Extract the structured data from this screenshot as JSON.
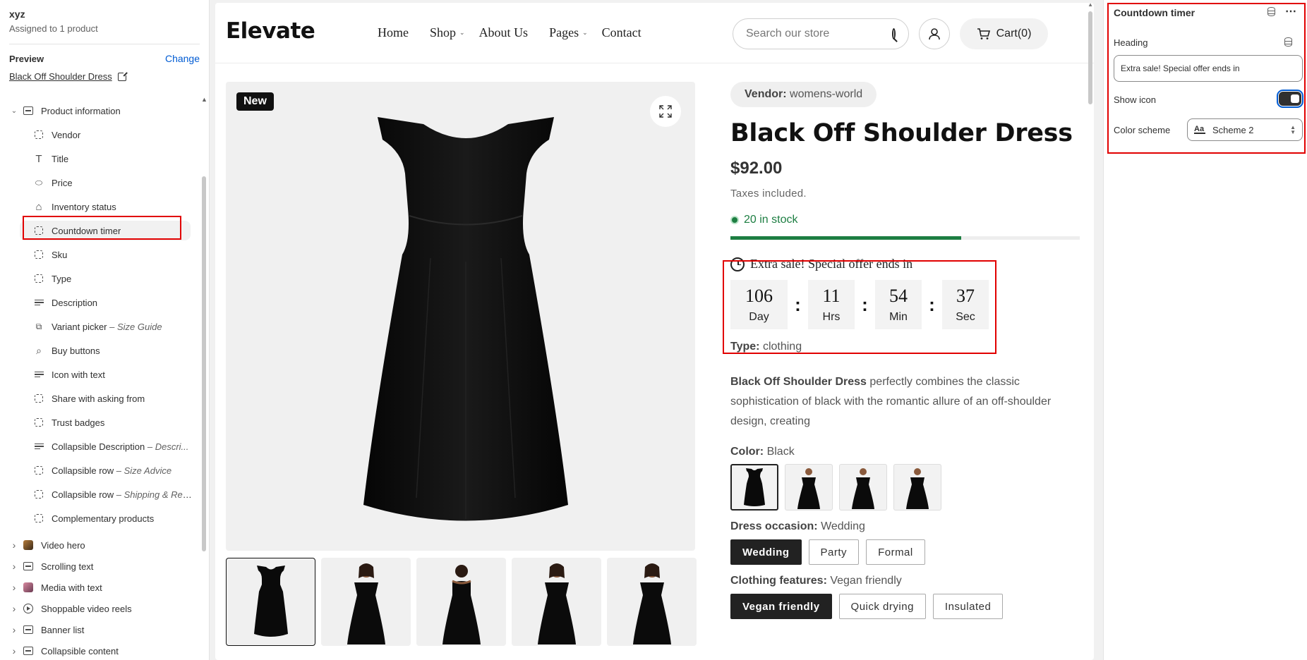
{
  "sidebar": {
    "title": "xyz",
    "subtitle": "Assigned to 1 product",
    "preview_label": "Preview",
    "change_label": "Change",
    "preview_link": "Black Off Shoulder Dress",
    "section_product": "Product information",
    "blocks": [
      {
        "label": "Vendor",
        "icon": "block-icon"
      },
      {
        "label": "Title",
        "icon": "title-icon"
      },
      {
        "label": "Price",
        "icon": "price-tag-icon"
      },
      {
        "label": "Inventory status",
        "icon": "inventory-icon"
      },
      {
        "label": "Countdown timer",
        "icon": "block-icon"
      },
      {
        "label": "Sku",
        "icon": "block-icon"
      },
      {
        "label": "Type",
        "icon": "block-icon"
      },
      {
        "label": "Description",
        "icon": "text-lines-icon"
      },
      {
        "label": "Variant picker",
        "suffix": "– Size Guide",
        "icon": "variant-icon"
      },
      {
        "label": "Buy buttons",
        "icon": "cart-button-icon"
      },
      {
        "label": "Icon with text",
        "icon": "text-lines-icon"
      },
      {
        "label": "Share with asking from",
        "icon": "block-icon"
      },
      {
        "label": "Trust badges",
        "icon": "block-icon"
      },
      {
        "label": "Collapsible Description",
        "suffix": "– Descri...",
        "icon": "text-lines-icon"
      },
      {
        "label": "Collapsible row",
        "suffix": "– Size Advice",
        "icon": "block-icon"
      },
      {
        "label": "Collapsible row",
        "suffix": "– Shipping & Ret...",
        "icon": "block-icon"
      },
      {
        "label": "Complementary products",
        "icon": "block-icon"
      }
    ],
    "sections": [
      {
        "label": "Video hero",
        "icon": "image-thumb-icon"
      },
      {
        "label": "Scrolling text",
        "icon": "section-icon"
      },
      {
        "label": "Media with text",
        "icon": "image-thumb-icon"
      },
      {
        "label": "Shoppable video reels",
        "icon": "play-icon"
      },
      {
        "label": "Banner list",
        "icon": "section-icon"
      },
      {
        "label": "Collapsible content",
        "icon": "section-icon"
      }
    ]
  },
  "store": {
    "logo": "Elevate",
    "nav": [
      "Home",
      "Shop",
      "About Us",
      "Pages",
      "Contact"
    ],
    "search_placeholder": "Search our store",
    "cart_label": "Cart(0)",
    "badge_new": "New",
    "vendor_label": "Vendor:",
    "vendor_value": "womens-world",
    "product_title": "Black Off Shoulder Dress",
    "price": "$92.00",
    "tax_note": "Taxes included.",
    "stock_text": "20 in stock",
    "stock_fraction": 0.66,
    "countdown": {
      "heading": "Extra sale! Special offer ends in",
      "units": [
        {
          "value": "106",
          "unit": "Day"
        },
        {
          "value": "11",
          "unit": "Hrs"
        },
        {
          "value": "54",
          "unit": "Min"
        },
        {
          "value": "37",
          "unit": "Sec"
        }
      ],
      "separator": ":"
    },
    "type_label": "Type:",
    "type_value": "clothing",
    "description_bold": "Black Off Shoulder Dress",
    "description_rest": " perfectly combines the classic sophistication of black with the romantic allure of an off-shoulder design, creating",
    "color_label": "Color:",
    "color_value": "Black",
    "occasion_label": "Dress occasion:",
    "occasion_value": "Wedding",
    "occasion_options": [
      "Wedding",
      "Party",
      "Formal"
    ],
    "features_label": "Clothing features:",
    "features_value": "Vegan friendly",
    "features_options": [
      "Vegan friendly",
      "Quick drying",
      "Insulated"
    ]
  },
  "settings": {
    "title": "Countdown timer",
    "heading_label": "Heading",
    "heading_value": "Extra sale! Special offer ends in",
    "show_icon_label": "Show icon",
    "show_icon": true,
    "color_scheme_label": "Color scheme",
    "color_scheme_value": "Scheme 2",
    "color_scheme_icon": "Aa"
  },
  "colors": {
    "highlight": "#e10000",
    "stock_green": "#1d7e42",
    "accent_blue": "#005bd3"
  }
}
